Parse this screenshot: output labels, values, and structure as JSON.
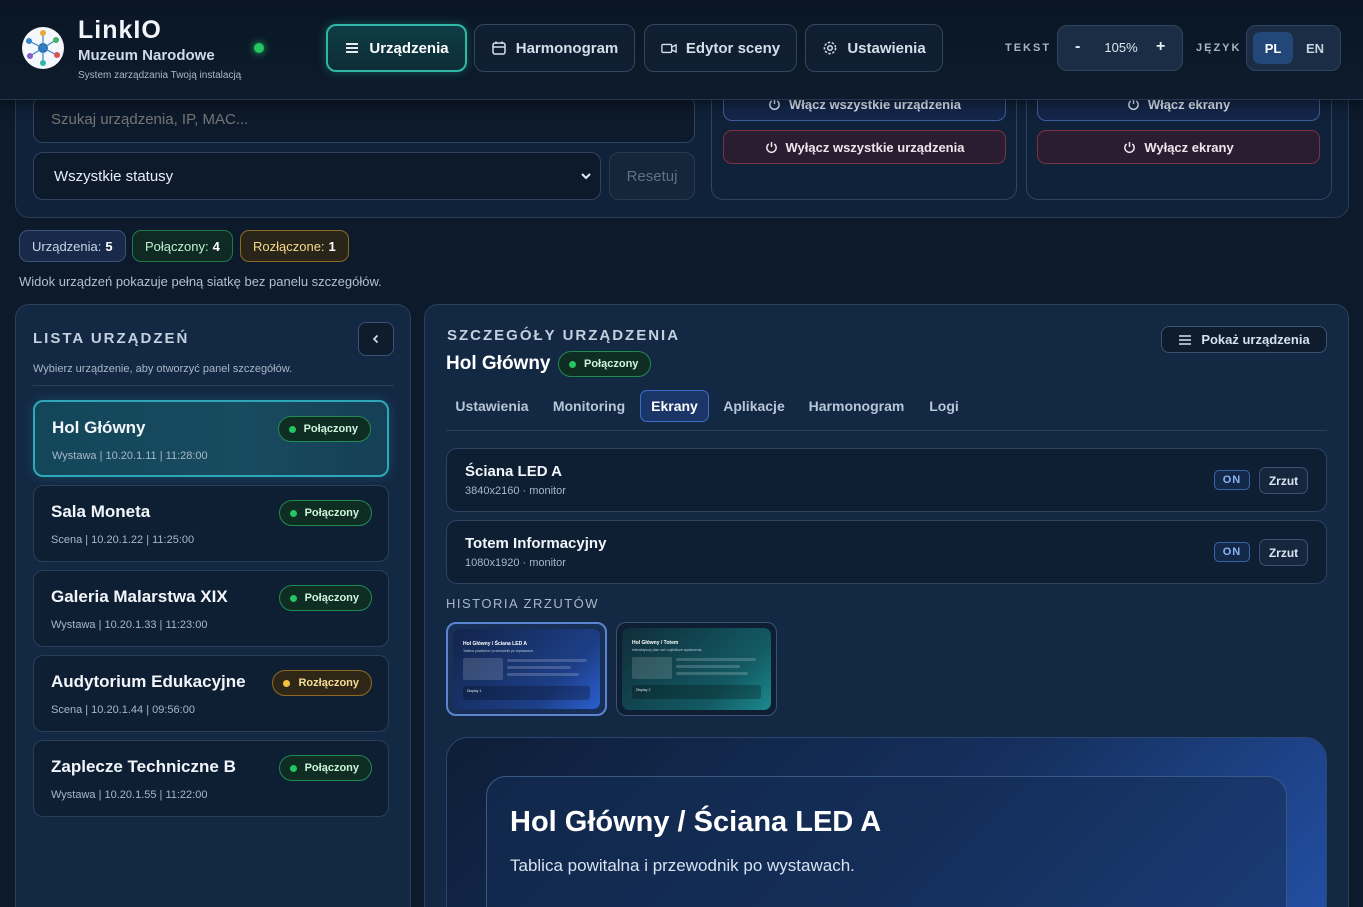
{
  "header": {
    "app_name": "LinkIO",
    "org": "Muzeum Narodowe",
    "tagline": "System zarządzania Twoją instalacją",
    "nav": [
      {
        "label": "Urządzenia",
        "icon": "menu-icon",
        "active": true
      },
      {
        "label": "Harmonogram",
        "icon": "calendar-icon",
        "active": false
      },
      {
        "label": "Edytor sceny",
        "icon": "camera-icon",
        "active": false
      },
      {
        "label": "Ustawienia",
        "icon": "gear-icon",
        "active": false
      }
    ],
    "text_label": "TEKST",
    "zoom_minus": "-",
    "zoom_value": "105%",
    "zoom_plus": "+",
    "lang_label": "JĘZYK",
    "lang_pl": "PL",
    "lang_en": "EN"
  },
  "filters": {
    "search_placeholder": "Szukaj urządzenia, IP, MAC...",
    "status_select": "Wszystkie statusy",
    "reset_label": "Resetuj"
  },
  "actions": {
    "devices_on": "Włącz wszystkie urządzenia",
    "devices_off": "Wyłącz wszystkie urządzenia",
    "screens_on": "Włącz ekrany",
    "screens_off": "Wyłącz ekrany"
  },
  "summary": {
    "all_label": "Urządzenia:",
    "all_count": "5",
    "connected_label": "Połączony:",
    "connected_count": "4",
    "disconnected_label": "Rozłączone:",
    "disconnected_count": "1",
    "note": "Widok urządzeń pokazuje pełną siatkę bez panelu szczegółów."
  },
  "device_list": {
    "title": "LISTA URZĄDZEŃ",
    "subtitle": "Wybierz urządzenie, aby otworzyć panel szczegółów.",
    "items": [
      {
        "name": "Hol Główny",
        "meta": "Wystawa | 10.20.1.11 | 11:28:00",
        "status": "Połączony",
        "connected": true,
        "selected": true
      },
      {
        "name": "Sala Moneta",
        "meta": "Scena | 10.20.1.22 | 11:25:00",
        "status": "Połączony",
        "connected": true,
        "selected": false
      },
      {
        "name": "Galeria Malarstwa XIX",
        "meta": "Wystawa | 10.20.1.33 | 11:23:00",
        "status": "Połączony",
        "connected": true,
        "selected": false
      },
      {
        "name": "Audytorium Edukacyjne",
        "meta": "Scena | 10.20.1.44 | 09:56:00",
        "status": "Rozłączony",
        "connected": false,
        "selected": false
      },
      {
        "name": "Zaplecze Techniczne B",
        "meta": "Wystawa | 10.20.1.55 | 11:22:00",
        "status": "Połączony",
        "connected": true,
        "selected": false
      }
    ]
  },
  "details": {
    "title": "SZCZEGÓŁY URZĄDZENIA",
    "device_name": "Hol Główny",
    "status": "Połączony",
    "show_devices": "Pokaż urządzenia",
    "tabs": [
      "Ustawienia",
      "Monitoring",
      "Ekrany",
      "Aplikacje",
      "Harmonogram",
      "Logi"
    ],
    "active_tab": "Ekrany",
    "screens": [
      {
        "name": "Ściana LED A",
        "meta": "3840x2160 · monitor",
        "state": "ON",
        "action": "Zrzut"
      },
      {
        "name": "Totem Informacyjny",
        "meta": "1080x1920 · monitor",
        "state": "ON",
        "action": "Zrzut"
      }
    ],
    "history_title": "HISTORIA ZRZUTÓW",
    "thumbnails": [
      {
        "title": "Hol Główny / Ściana LED A",
        "subtitle": "Tablica powitalna i przewodnik po wystawach.",
        "footer": "Display 1"
      },
      {
        "title": "Hol Główny / Totem",
        "subtitle": "Interaktywny plan sal i najbliższe wydarzenia.",
        "footer": "Display 2"
      }
    ],
    "preview_title": "Hol Główny / Ściana LED A",
    "preview_subtitle": "Tablica powitalna i przewodnik po wystawach."
  },
  "colors": {
    "accent": "#2fb7a8",
    "connected": "#22c55e",
    "disconnected": "#f5c33b",
    "tab_active": "#1a3668"
  }
}
